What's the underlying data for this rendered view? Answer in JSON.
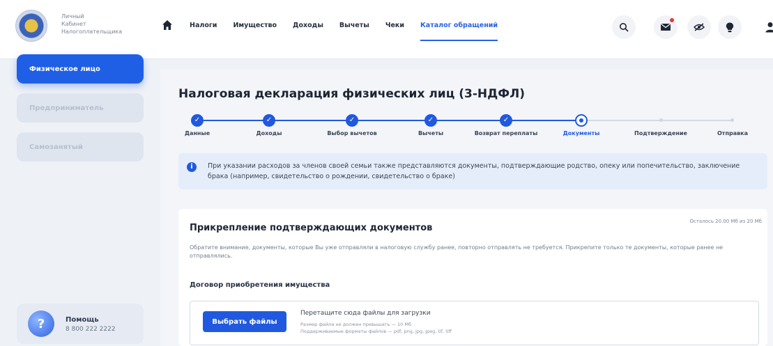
{
  "brand": {
    "line1": "Личный",
    "line2": "Кабинет",
    "line3": "Налогоплательщика"
  },
  "topnav": {
    "items": [
      "Налоги",
      "Имущество",
      "Доходы",
      "Вычеты",
      "Чеки",
      "Каталог обращений"
    ],
    "active": "Каталог обращений"
  },
  "header_icons": [
    "search-icon",
    "mail-icon",
    "eye-off-icon",
    "lightbulb-icon",
    "user-icon"
  ],
  "sidebar": {
    "items": [
      {
        "label": "Физическое лицо",
        "active": true
      },
      {
        "label": "Предприниматель",
        "active": false
      },
      {
        "label": "Самозанятый",
        "active": false
      }
    ],
    "help_title": "Помощь",
    "help_phone": "8 800 222 2222",
    "help_badge": "?"
  },
  "page": {
    "title": "Налоговая декларация физических лиц (3-НДФЛ)"
  },
  "steps": [
    {
      "label": "Данные",
      "state": "done"
    },
    {
      "label": "Доходы",
      "state": "done"
    },
    {
      "label": "Выбор вычетов",
      "state": "done"
    },
    {
      "label": "Вычеты",
      "state": "done"
    },
    {
      "label": "Возврат переплаты",
      "state": "done"
    },
    {
      "label": "Документы",
      "state": "current"
    },
    {
      "label": "Подтверждение",
      "state": "future"
    },
    {
      "label": "Отправка",
      "state": "future"
    }
  ],
  "info": {
    "icon": "i",
    "text": "При указании расходов за членов своей семьи также представляются документы, подтверждающие родство, опеку или попечительство, заключение брака (например, свидетельство о рождении, свидетельство о браке)"
  },
  "attachments": {
    "title": "Прикрепление подтверждающих документов",
    "quota": "Осталось 20.00 Мб из 20 Мб",
    "notice": "Обратите внимание, документы, которые Вы уже отправляли в налоговую службу ранее, повторно отправлять не требуется. Прикрепите только те документы, которые ранее не отправлялись.",
    "section_title": "Договор приобретения имущества",
    "choose_button": "Выбрать файлы",
    "drop_title": "Перетащите сюда файлы для загрузки",
    "drop_limit": "Размер файла не должен превышать — 10 Мб",
    "drop_formats": "Поддерживаемые форматы файлов — pdf, png, jpg, jpeg, tif, tiff"
  },
  "colors": {
    "accent": "#2059e0",
    "sidebar_active": "#1f5fe6",
    "notify": "#e53935"
  }
}
